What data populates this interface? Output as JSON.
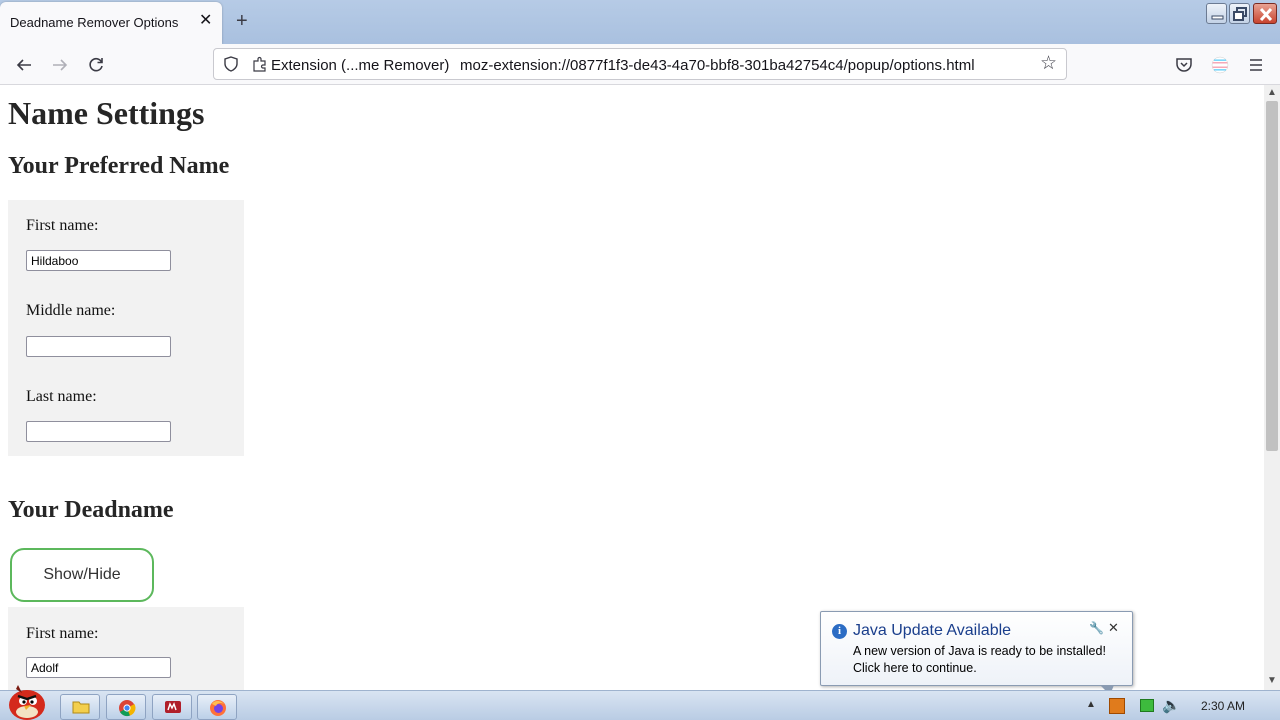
{
  "browser": {
    "tab_title": "Deadname Remover Options",
    "tab_close": "✕",
    "new_tab": "+",
    "address_identity": "Extension (...me Remover)",
    "url": "moz-extension://0877f1f3-de43-4a70-bbf8-301ba42754c4/popup/options.html"
  },
  "page": {
    "title": "Name Settings",
    "preferred": {
      "heading": "Your Preferred Name",
      "first_label": "First name:",
      "first_value": "Hildaboo",
      "middle_label": "Middle name:",
      "middle_value": "",
      "last_label": "Last name:",
      "last_value": ""
    },
    "deadname": {
      "heading": "Your Deadname",
      "toggle_label": "Show/Hide",
      "first_label": "First name:",
      "first_value": "Adolf"
    }
  },
  "notification": {
    "title": "Java Update Available",
    "line1": "A new version of Java is ready to be installed!",
    "line2": "Click here to continue.",
    "close": "✕"
  },
  "taskbar": {
    "clock": "2:30 AM"
  },
  "colors": {
    "tab_strip": "#b6cbe6",
    "page_bg": "#ffffff",
    "section_box": "#f2f2f2",
    "toggle_border": "#5cb85c",
    "notification_title": "#1a3e8c"
  }
}
